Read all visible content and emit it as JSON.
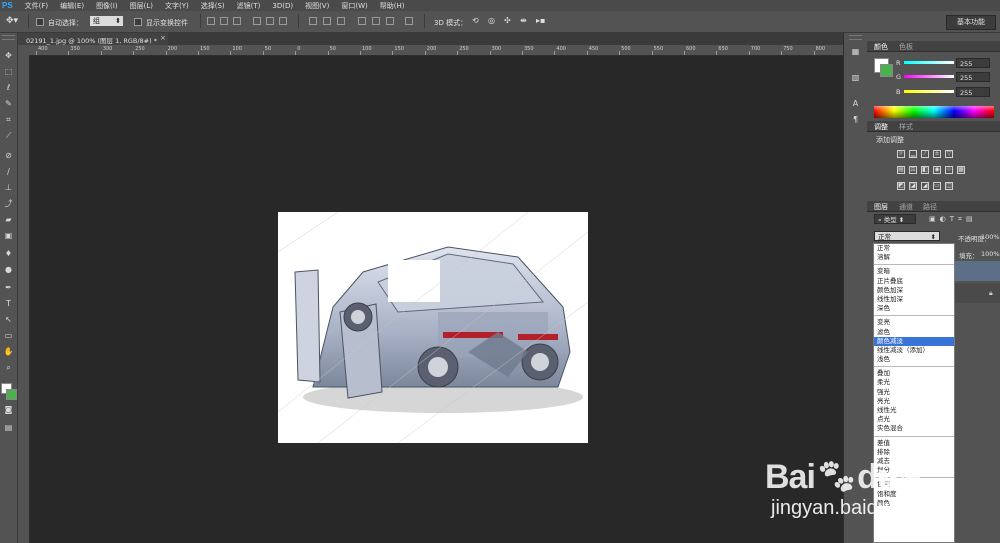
{
  "app": {
    "logo": "PS"
  },
  "menu": [
    "文件(F)",
    "编辑(E)",
    "图像(I)",
    "图层(L)",
    "文字(Y)",
    "选择(S)",
    "滤镜(T)",
    "3D(D)",
    "视图(V)",
    "窗口(W)",
    "帮助(H)"
  ],
  "options": {
    "auto_select_label": "自动选择：",
    "auto_select_value": "组",
    "show_transform_label": "显示变换控件",
    "mode_3d_label": "3D 模式：",
    "workspace": "基本功能"
  },
  "document": {
    "tab_title": "02191_1.jpg @ 100% (图层 1, RGB/8#) *",
    "close": "×",
    "ruler_ticks": [
      "400",
      "350",
      "300",
      "250",
      "200",
      "150",
      "100",
      "50",
      "0",
      "50",
      "100",
      "150",
      "200",
      "250",
      "300",
      "350",
      "400",
      "450",
      "500",
      "550",
      "600",
      "650",
      "700",
      "750",
      "800"
    ]
  },
  "color_panel": {
    "tabs": [
      "颜色",
      "色板"
    ],
    "channels": [
      {
        "label": "R",
        "value": "255",
        "color": "#ff3030"
      },
      {
        "label": "G",
        "value": "255",
        "color": "#30ff30"
      },
      {
        "label": "B",
        "value": "255",
        "color": "#3030ff"
      }
    ],
    "foreground": "#ffffff",
    "background": "#4caf50"
  },
  "adjustments_panel": {
    "tabs": [
      "调整",
      "样式"
    ],
    "title": "添加调整"
  },
  "layers_panel": {
    "tabs": [
      "图层",
      "通道",
      "路径"
    ],
    "filter_kind": "类型",
    "blend_mode": "正常",
    "opacity_label": "不透明度：",
    "opacity_value": "100%",
    "fill_label": "填充：",
    "fill_value": "100%"
  },
  "blend_modes": {
    "groups": [
      [
        "正常",
        "溶解"
      ],
      [
        "变暗",
        "正片叠底",
        "颜色加深",
        "线性加深",
        "深色"
      ],
      [
        "变亮",
        "滤色",
        "颜色减淡",
        "线性减淡（添加）",
        "浅色"
      ],
      [
        "叠加",
        "柔光",
        "强光",
        "亮光",
        "线性光",
        "点光",
        "实色混合"
      ],
      [
        "差值",
        "排除",
        "减去",
        "划分"
      ],
      [
        "色相",
        "饱和度",
        "颜色"
      ]
    ],
    "selected": "颜色减淡"
  },
  "watermark": {
    "logo": "Bai",
    "logo2": "du",
    "sub": "经验",
    "url": "jingyan.baidu.com"
  },
  "icons": {
    "tools": [
      "move-icon",
      "marquee-icon",
      "lasso-icon",
      "quick-select-icon",
      "crop-icon",
      "eyedropper-icon",
      "healing-icon",
      "brush-icon",
      "stamp-icon",
      "history-brush-icon",
      "eraser-icon",
      "gradient-icon",
      "blur-icon",
      "dodge-icon",
      "pen-icon",
      "type-icon",
      "path-select-icon",
      "shape-icon",
      "hand-icon",
      "zoom-icon"
    ]
  }
}
